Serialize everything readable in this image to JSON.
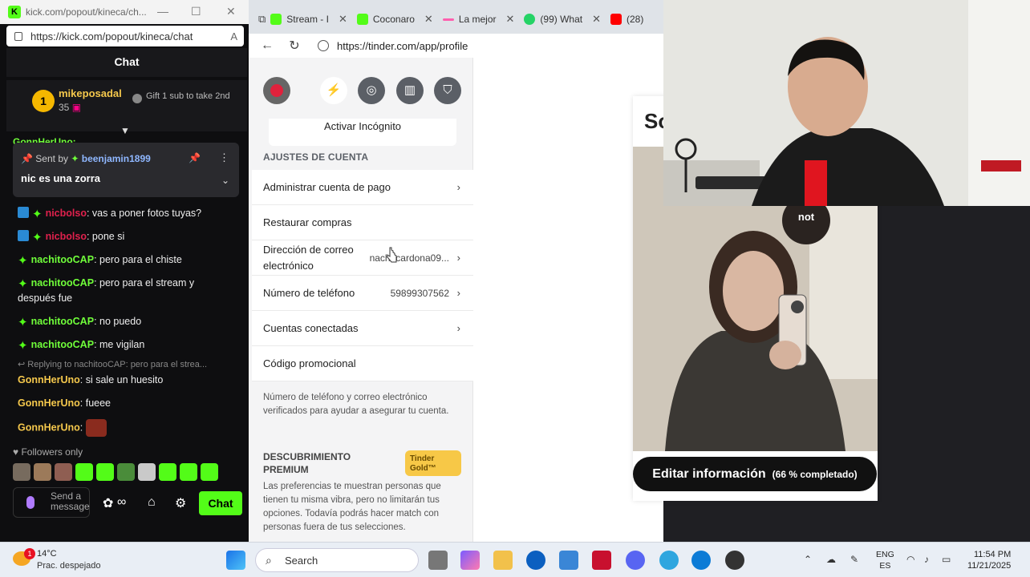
{
  "kick": {
    "window_title": "kick.com/popout/kineca/ch...",
    "url": "https://kick.com/popout/kineca/chat",
    "chat_header": "Chat",
    "gifter": {
      "rank": "1",
      "name": "mikeposadal",
      "count": "35",
      "cta": "Gift 1 sub to take 2nd"
    },
    "pinned": {
      "sent_by_label": "Sent by",
      "user": "beenjamin1899",
      "message": "nic es una zorra"
    },
    "messages": [
      {
        "user": "nicbolso",
        "text": ": vas a poner fotos tuyas?"
      },
      {
        "user": "nicbolso",
        "text": ": pone si"
      },
      {
        "user": "nachitooCAP",
        "text": ": pero para el chiste"
      },
      {
        "user": "nachitooCAP",
        "text": ": pero para el stream y después fue"
      },
      {
        "user": "nachitooCAP",
        "text": ": no puedo"
      },
      {
        "user": "nachitooCAP",
        "text": ": me vigilan"
      },
      {
        "reply": "Replying to nachitooCAP: pero para el strea...",
        "user": "GonnHerUno",
        "text": ": si sale un huesito"
      },
      {
        "user": "GonnHerUno",
        "text": ": fueee"
      },
      {
        "user": "GonnHerUno",
        "text": ":"
      }
    ],
    "followers_only": "Followers only",
    "input_placeholder": "Send a message",
    "chat_button": "Chat"
  },
  "browser": {
    "tabs": [
      {
        "label": "Stream - I",
        "color": "#53fc18"
      },
      {
        "label": "Coconaro",
        "color": "#53fc18"
      },
      {
        "label": "La mejor",
        "color": "#ff5fae"
      },
      {
        "label": "(99) What",
        "color": "#25d366"
      },
      {
        "label": "(28)",
        "color": "#ff0000"
      }
    ],
    "url": "https://tinder.com/app/profile"
  },
  "tinder": {
    "incognito_button": "Activar Incógnito",
    "account_heading": "AJUSTES DE CUENTA",
    "rows": [
      {
        "label": "Administrar cuenta de pago",
        "value": ""
      },
      {
        "label": "Restaurar compras",
        "value": ""
      },
      {
        "label": "Dirección de correo electrónico",
        "value": "nachocardona09..."
      },
      {
        "label": "Número de teléfono",
        "value": "59899307562"
      },
      {
        "label": "Cuentas conectadas",
        "value": ""
      },
      {
        "label": "Código promocional",
        "value": ""
      }
    ],
    "note": "Número de teléfono y correo electrónico verificados para ayudar a asegurar tu cuenta.",
    "discovery_heading": "DESCUBRIMIENTO PREMIUM",
    "gold_badge": "Tinder Gold™",
    "discovery_text": "Las preferencias te muestran personas que tienen tu misma vibra, pero no limitarán tus opciones. Todavía podrás hacer match con personas fuera de tus selecciones.",
    "profile_title_fragment": "So",
    "edit_button": "Editar información",
    "edit_progress": "(66 % completado)"
  },
  "taskbar": {
    "temperature": "14°C",
    "weather": "Prac. despejado",
    "search_placeholder": "Search",
    "lang_top": "ENG",
    "lang_bottom": "ES",
    "time": "11:54 PM",
    "date": "11/21/2025"
  }
}
